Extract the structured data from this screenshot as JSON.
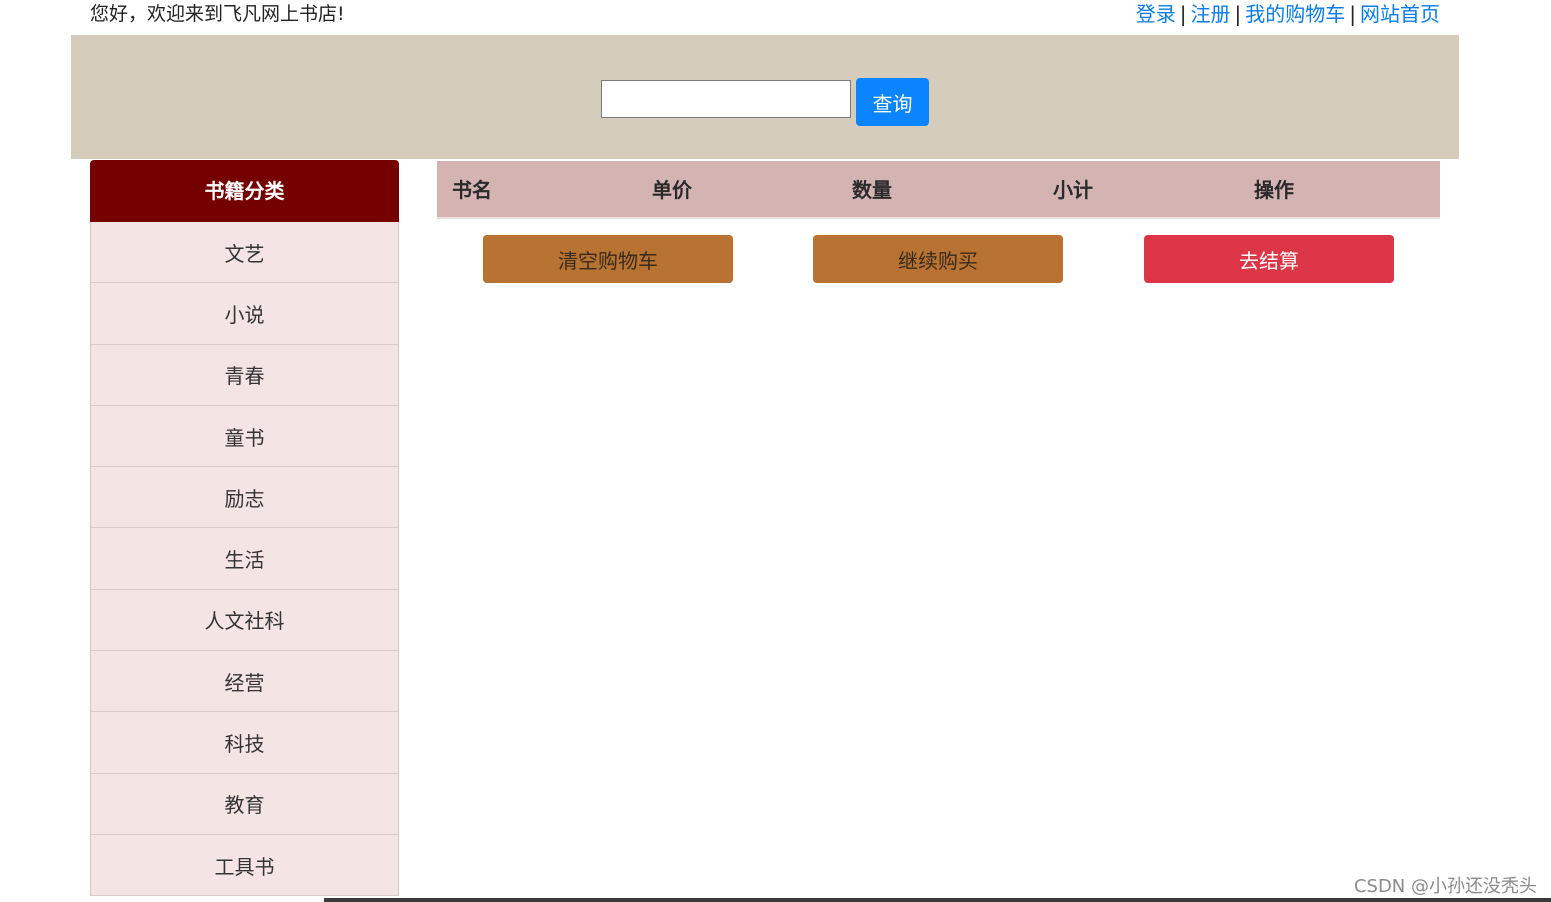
{
  "topbar": {
    "welcome": "您好，欢迎来到飞凡网上书店!",
    "links": [
      "登录",
      "注册",
      "我的购物车",
      "网站首页"
    ],
    "separator": "|"
  },
  "search": {
    "value": "",
    "placeholder": "",
    "button_label": "查询"
  },
  "sidebar": {
    "title": "书籍分类",
    "items": [
      "文艺",
      "小说",
      "青春",
      "童书",
      "励志",
      "生活",
      "人文社科",
      "经营",
      "科技",
      "教育",
      "工具书"
    ]
  },
  "cart": {
    "columns": [
      "书名",
      "单价",
      "数量",
      "小计",
      "操作"
    ],
    "buttons": {
      "clear": "清空购物车",
      "continue": "继续购买",
      "checkout": "去结算"
    }
  },
  "watermark": "CSDN @小孙还没秃头",
  "colors": {
    "band": "#d6ccbb",
    "sidebar_header": "#740000",
    "sidebar_item": "#f5e4e4",
    "table_header": "#d4b3b3",
    "search_button": "#0a84ff",
    "brown_button": "#b87333",
    "checkout_button": "#dc3545",
    "link": "#0a7ce8"
  }
}
